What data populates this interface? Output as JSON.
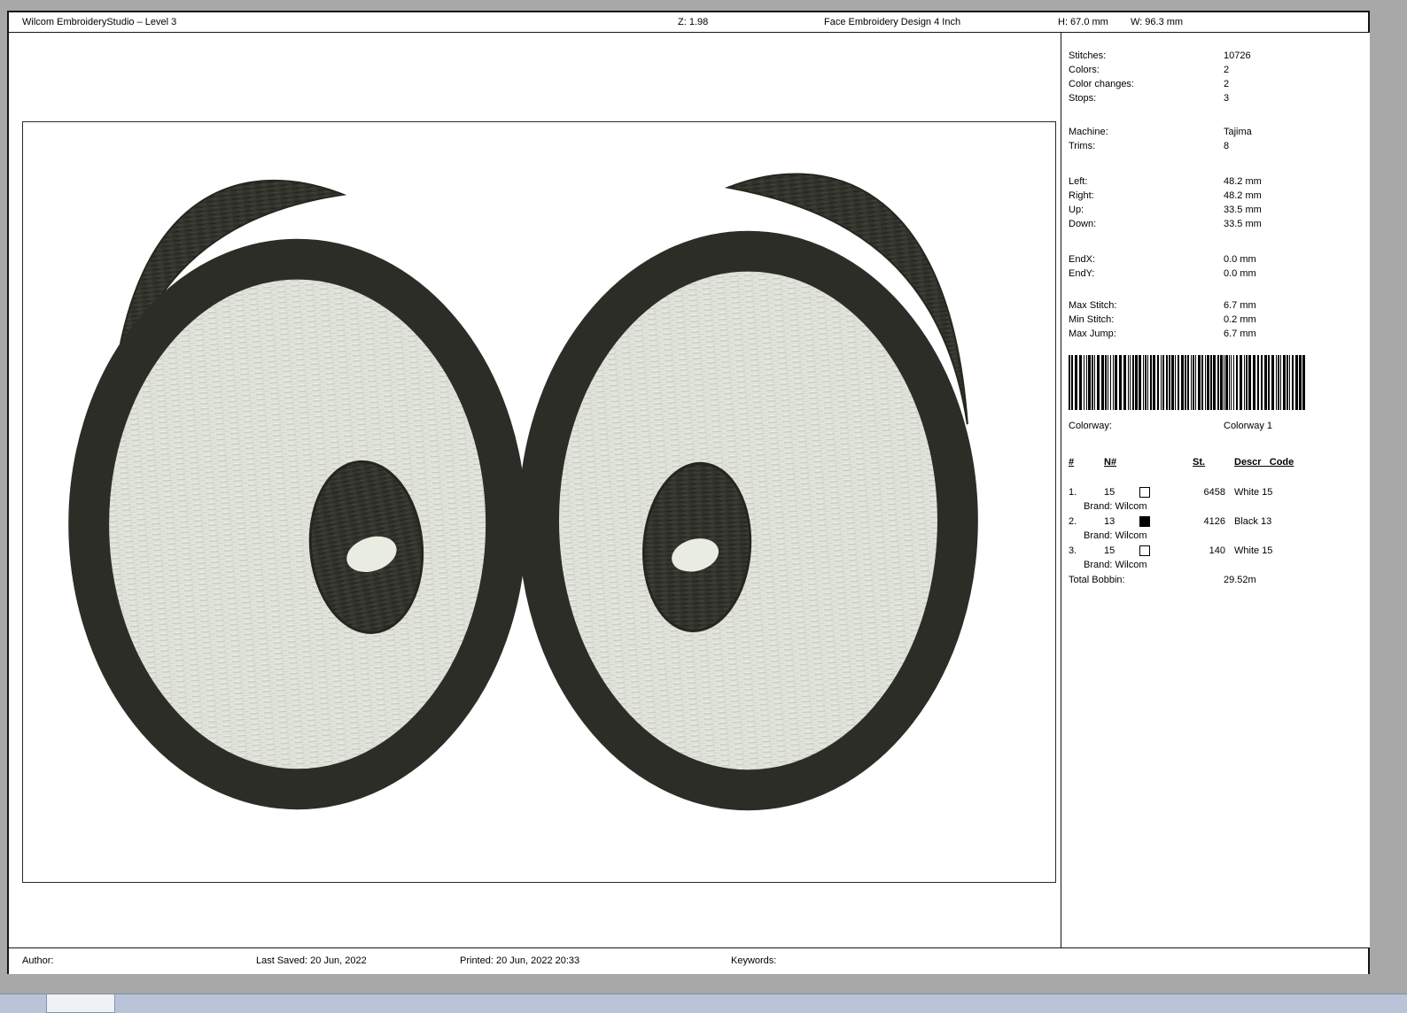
{
  "header": {
    "app_title": "Wilcom EmbroideryStudio – Level 3",
    "zoom": "Z: 1.98",
    "design_title": "Face Embroidery Design 4  Inch",
    "dim_h": "H: 67.0 mm",
    "dim_w": "W: 96.3 mm"
  },
  "info_panel": {
    "stats": [
      {
        "label": "Stitches:",
        "value": "10726"
      },
      {
        "label": "Colors:",
        "value": "2"
      },
      {
        "label": "Color changes:",
        "value": "2"
      },
      {
        "label": "Stops:",
        "value": "3"
      }
    ],
    "machine": [
      {
        "label": "Machine:",
        "value": "Tajima"
      },
      {
        "label": "Trims:",
        "value": "8"
      }
    ],
    "extents": [
      {
        "label": "Left:",
        "value": "48.2 mm"
      },
      {
        "label": "Right:",
        "value": "48.2 mm"
      },
      {
        "label": "Up:",
        "value": "33.5 mm"
      },
      {
        "label": "Down:",
        "value": "33.5 mm"
      }
    ],
    "end_point": [
      {
        "label": "EndX:",
        "value": "0.0 mm"
      },
      {
        "label": "EndY:",
        "value": "0.0 mm"
      }
    ],
    "stitch_limits": [
      {
        "label": "Max Stitch:",
        "value": "6.7 mm"
      },
      {
        "label": "Min Stitch:",
        "value": "0.2 mm"
      },
      {
        "label": "Max Jump:",
        "value": "6.7 mm"
      }
    ],
    "colorway_label": "Colorway:",
    "colorway_value": "Colorway 1",
    "thread_table": {
      "headers": {
        "num": "#",
        "n": "N#",
        "st": "St.",
        "descr": "Descr _Code"
      },
      "rows": [
        {
          "num": "1.",
          "n": "15",
          "swatch": "#ffffff",
          "st": "6458",
          "descr": "White 15",
          "brand": "Brand: Wilcom"
        },
        {
          "num": "2.",
          "n": "13",
          "swatch": "#000000",
          "st": "4126",
          "descr": "Black 13",
          "brand": "Brand: Wilcom"
        },
        {
          "num": "3.",
          "n": "15",
          "swatch": "#ffffff",
          "st": "140",
          "descr": "White 15",
          "brand": "Brand: Wilcom"
        }
      ],
      "total_label": "Total Bobbin:",
      "total_value": "29.52m"
    }
  },
  "footer": {
    "author": "Author:",
    "last_saved": "Last Saved: 20 Jun, 2022",
    "printed": "Printed: 20 Jun, 2022 20:33",
    "keywords": "Keywords:"
  },
  "design": {
    "palette": {
      "outline": "#2d2d27",
      "fill_light": "#e0e3da",
      "pupil_dark": "#34342e",
      "highlight": "#e9ece1"
    }
  }
}
